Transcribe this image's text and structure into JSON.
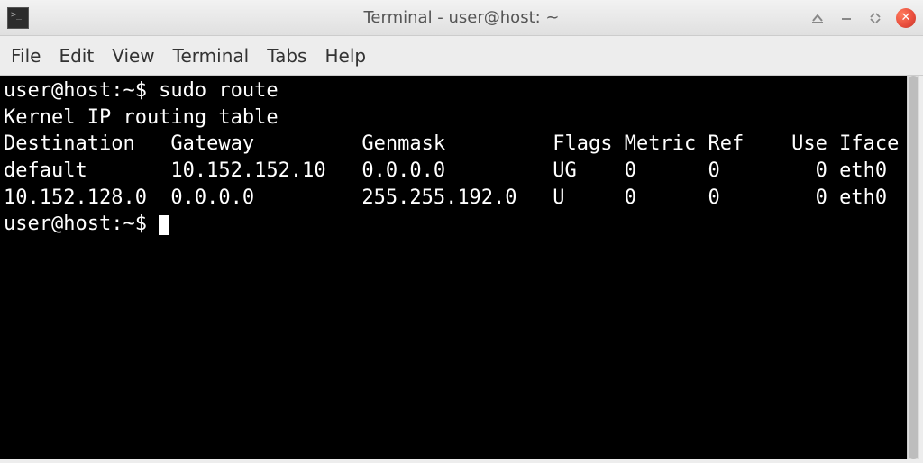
{
  "window": {
    "title": "Terminal - user@host: ~"
  },
  "menu": {
    "items": [
      "File",
      "Edit",
      "View",
      "Terminal",
      "Tabs",
      "Help"
    ]
  },
  "terminal": {
    "prompt1": "user@host:~$ ",
    "command1": "sudo route",
    "heading": "Kernel IP routing table",
    "cols": {
      "dest": "Destination",
      "gw": "Gateway",
      "mask": "Genmask",
      "flags": "Flags",
      "metric": "Metric",
      "ref": "Ref",
      "use": "Use",
      "iface": "Iface"
    },
    "rows": [
      {
        "dest": "default",
        "gw": "10.152.152.10",
        "mask": "0.0.0.0",
        "flags": "UG",
        "metric": "0",
        "ref": "0",
        "use": "0",
        "iface": "eth0"
      },
      {
        "dest": "10.152.128.0",
        "gw": "0.0.0.0",
        "mask": "255.255.192.0",
        "flags": "U",
        "metric": "0",
        "ref": "0",
        "use": "0",
        "iface": "eth0"
      }
    ],
    "prompt2": "user@host:~$ "
  }
}
